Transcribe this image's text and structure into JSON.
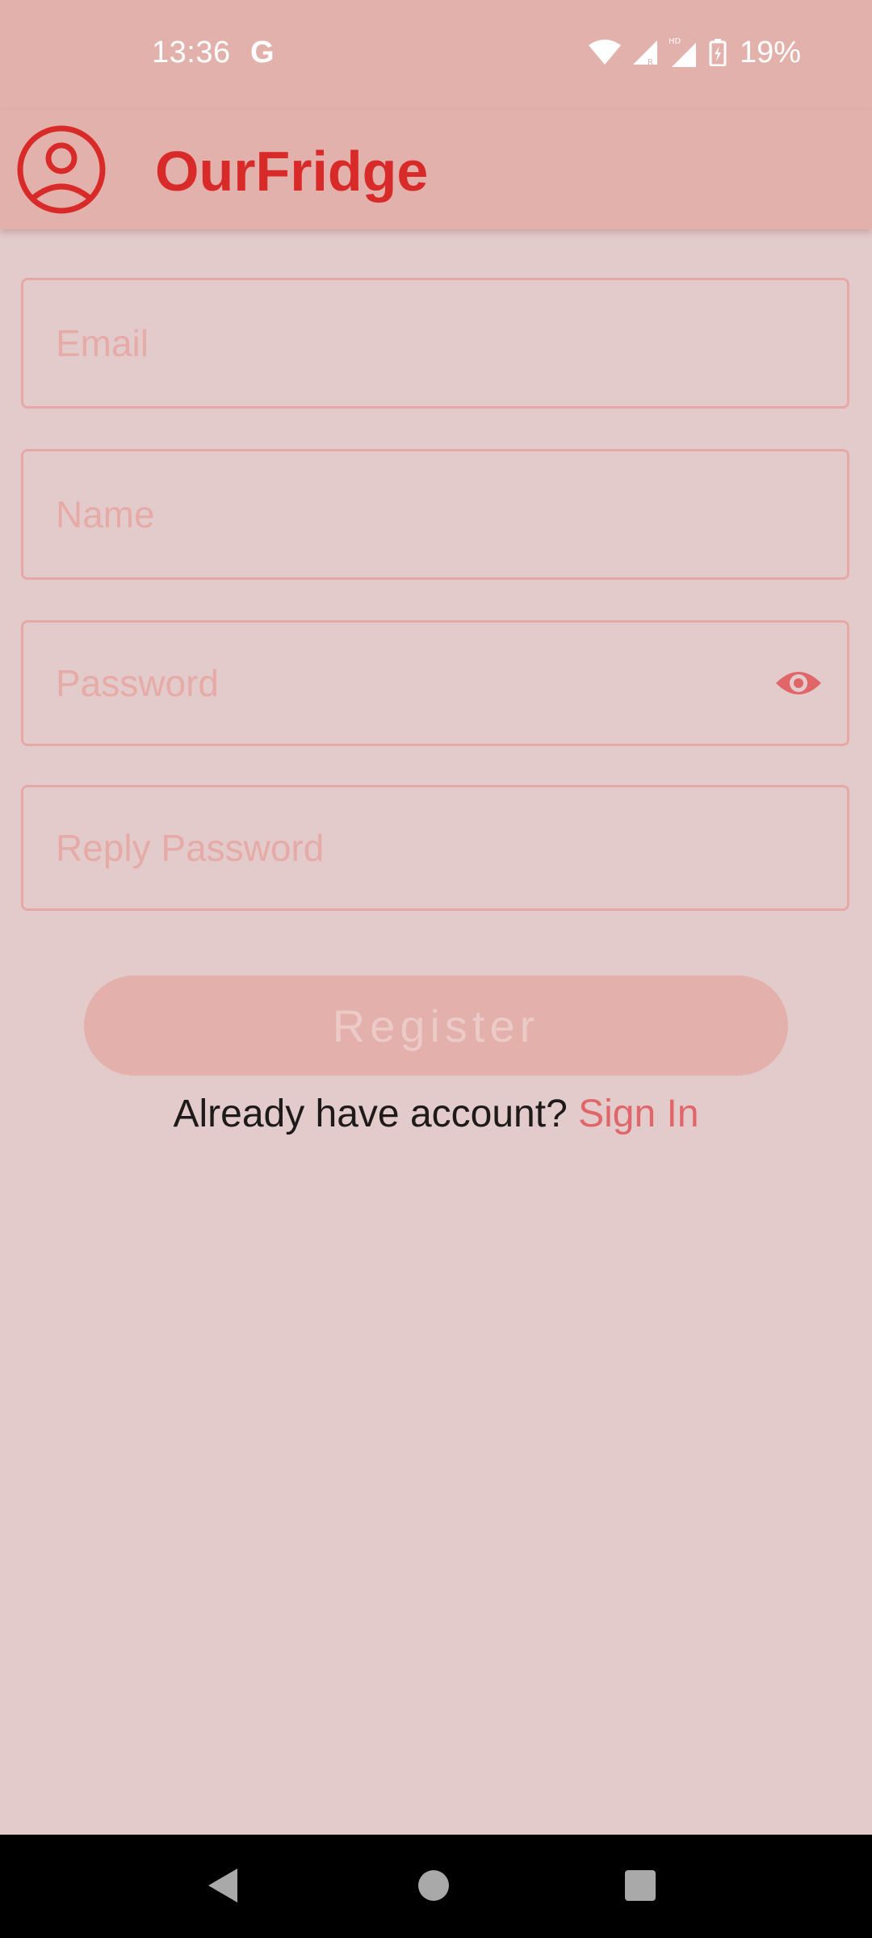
{
  "status_bar": {
    "time": "13:36",
    "g_label": "G",
    "hd_label": "HD",
    "battery": "19%"
  },
  "app_bar": {
    "title": "OurFridge",
    "avatar_icon": "account-circle-icon"
  },
  "form": {
    "email_placeholder": "Email",
    "name_placeholder": "Name",
    "password_placeholder": "Password",
    "reply_password_placeholder": "Reply Password",
    "password_toggle_icon": "eye-icon",
    "register_label": "Register",
    "signin_prompt": "Already have account? ",
    "signin_link": "Sign In"
  },
  "colors": {
    "background": "#e3cbcb",
    "app_bar": "#e3b1ac",
    "accent": "#d92a2a",
    "link": "#e0666a",
    "field_border": "#e7a9a6"
  },
  "nav_bar": {
    "back_icon": "back-triangle-icon",
    "home_icon": "home-circle-icon",
    "recents_icon": "recents-square-icon"
  }
}
